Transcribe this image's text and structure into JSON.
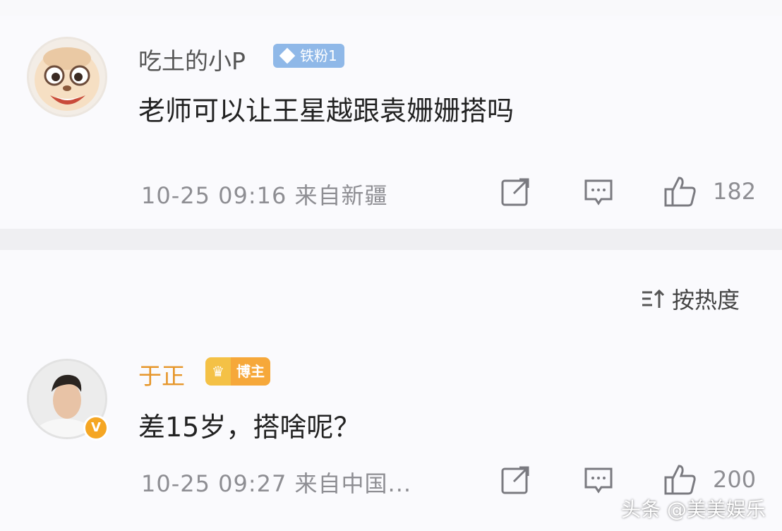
{
  "comments": [
    {
      "username": "吃土的小P",
      "badge": "铁粉1",
      "text": "老师可以让王星越跟袁姗姗搭吗",
      "meta": "10-25 09:16 来自新疆",
      "like_count": "182",
      "avatar_icon": "cartoon-face-avatar"
    },
    {
      "username": "于正",
      "badge": "博主",
      "text": "差15岁，搭啥呢？",
      "meta": "10-25 09:27 来自中国...",
      "like_count": "200",
      "avatar_icon": "person-photo-avatar",
      "verified_mark": "V"
    }
  ],
  "sort": {
    "label": "按热度",
    "icon": "sort-icon"
  },
  "watermark": "头条 @美美娱乐",
  "colors": {
    "username": "#555555",
    "blogger_name": "#e6962a",
    "meta": "#8e8e93",
    "fan_badge": "#8fb8e8",
    "blogger_badge": "#f6a83a"
  }
}
